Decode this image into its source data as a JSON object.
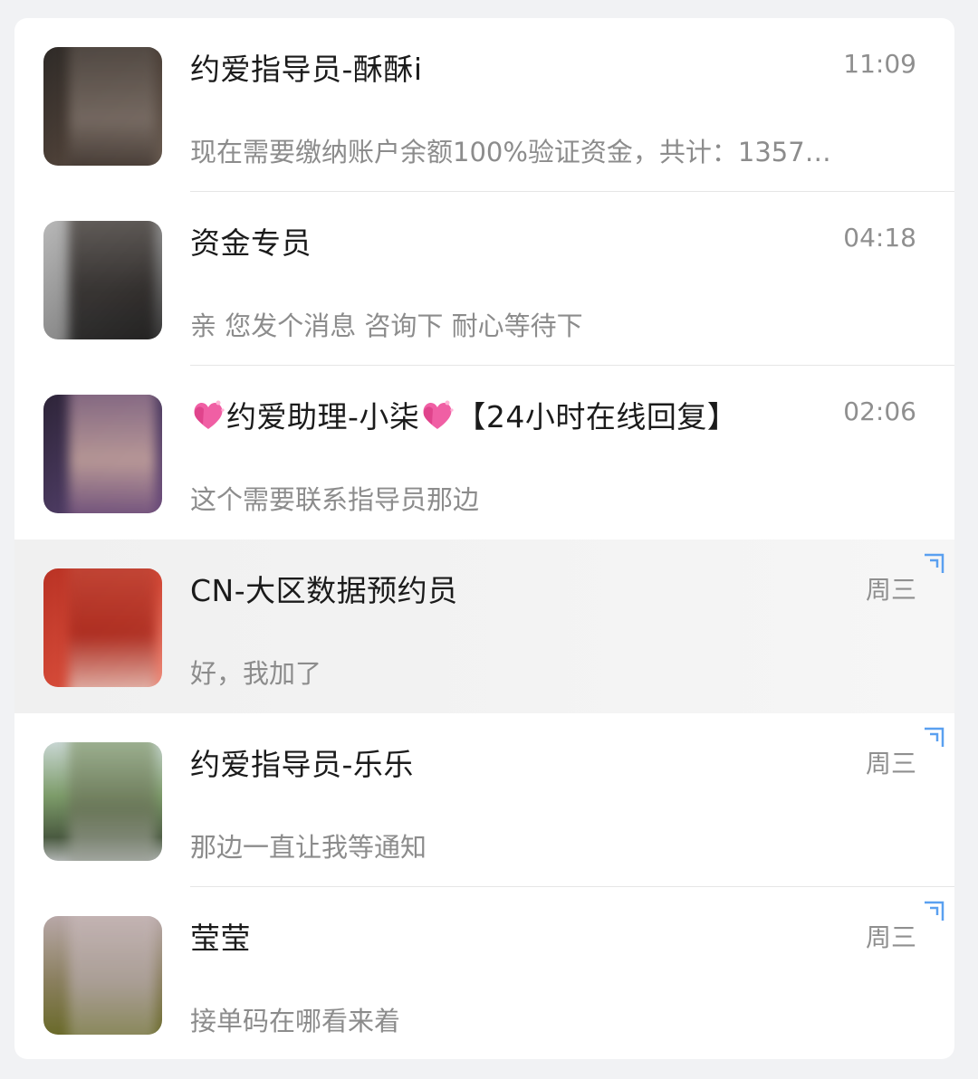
{
  "conversations": [
    {
      "name": "约爱指导员-酥酥i",
      "time": "11:09",
      "preview": "现在需要缴纳账户余额100%验证资金，共计：1357…",
      "pinned": false,
      "avatar_colors": [
        "#2e2a27",
        "#6b5d52"
      ]
    },
    {
      "name": "资金专员",
      "time": "04:18",
      "preview": "亲 您发个消息 咨询下 耐心等待下",
      "pinned": false,
      "avatar_colors": [
        "#a9a9a9",
        "#343434"
      ]
    },
    {
      "name_prefix": "约爱助理-小柒",
      "name_suffix": "【24小时在线回复】",
      "time": "02:06",
      "preview": "这个需要联系指导员那边",
      "pinned": false,
      "avatar_colors": [
        "#3a2a4a",
        "#c9a99a"
      ]
    },
    {
      "name": "CN-大区数据预约员",
      "time": "周三",
      "preview": "好，我加了",
      "pinned": true,
      "avatar_colors": [
        "#c43a2c",
        "#e8705e"
      ]
    },
    {
      "name": "约爱指导员-乐乐",
      "time": "周三",
      "preview": "那边一直让我等通知",
      "pinned": true,
      "avatar_colors": [
        "#7c9a6a",
        "#bcc9c0"
      ]
    },
    {
      "name": "莹莹",
      "time": "周三",
      "preview": "接单码在哪看来着",
      "pinned": true,
      "avatar_colors": [
        "#8a7f5e",
        "#c9b7b0"
      ]
    }
  ],
  "icons": {
    "heart": "sparkling-heart-emoji",
    "corner": "corner-bracket-icon"
  },
  "colors": {
    "accent_corner": "#5aa0f0",
    "heart": "#f05fa4"
  }
}
